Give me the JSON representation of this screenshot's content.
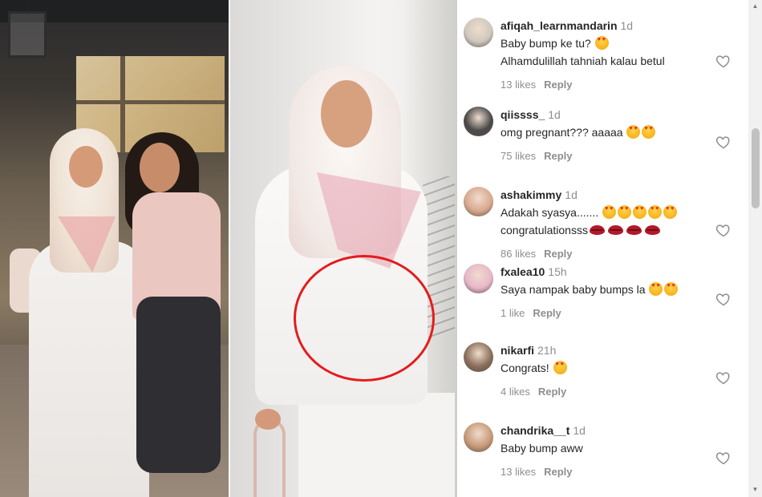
{
  "comments": [
    {
      "username": "afiqah_learnmandarin",
      "time": "1d",
      "lines": [
        [
          "Baby bump ke tu? ",
          "love-eyes"
        ],
        [
          "Alhamdulillah tahniah kalau betul"
        ]
      ],
      "likes": "13 likes",
      "reply": "Reply",
      "avatar_color": "#cfc8be"
    },
    {
      "username": "qiissss_",
      "time": "1d",
      "lines": [
        [
          "omg pregnant??? aaaaa ",
          "love-eyes",
          "love-eyes"
        ]
      ],
      "likes": "75 likes",
      "reply": "Reply",
      "avatar_color": "#4a4a4a"
    },
    {
      "username": "ashakimmy",
      "time": "1d",
      "lines": [
        [
          "Adakah syasya....... ",
          "love-eyes",
          "love-eyes",
          "love-eyes",
          "love-eyes",
          "love-eyes"
        ],
        [
          "congratulationsss",
          "lips",
          "lips",
          "lips",
          "lips"
        ]
      ],
      "likes": "86 likes",
      "reply": "Reply",
      "avatar_color": "#d9a98f"
    },
    {
      "username": "fxalea10",
      "time": "15h",
      "lines": [
        [
          "Saya nampak baby bumps la ",
          "love-eyes",
          "love-eyes"
        ]
      ],
      "likes": "1 like",
      "reply": "Reply",
      "avatar_color": "#e7b7c9"
    },
    {
      "username": "nikarfi",
      "time": "21h",
      "lines": [
        [
          "Congrats! ",
          "love-eyes"
        ]
      ],
      "likes": "4 likes",
      "reply": "Reply",
      "avatar_color": "#8a6e5a"
    },
    {
      "username": "chandrika__t",
      "time": "1d",
      "lines": [
        [
          "Baby bump aww"
        ]
      ],
      "likes": "13 likes",
      "reply": "Reply",
      "avatar_color": "#c79a78"
    }
  ],
  "colors": {
    "username": "#262626",
    "muted": "#8e8e8e",
    "highlight_circle": "#e41c1c"
  },
  "icons": {
    "like": "heart-outline-icon",
    "love": "heart-eyes-emoji",
    "kiss": "kiss-lips-emoji"
  }
}
